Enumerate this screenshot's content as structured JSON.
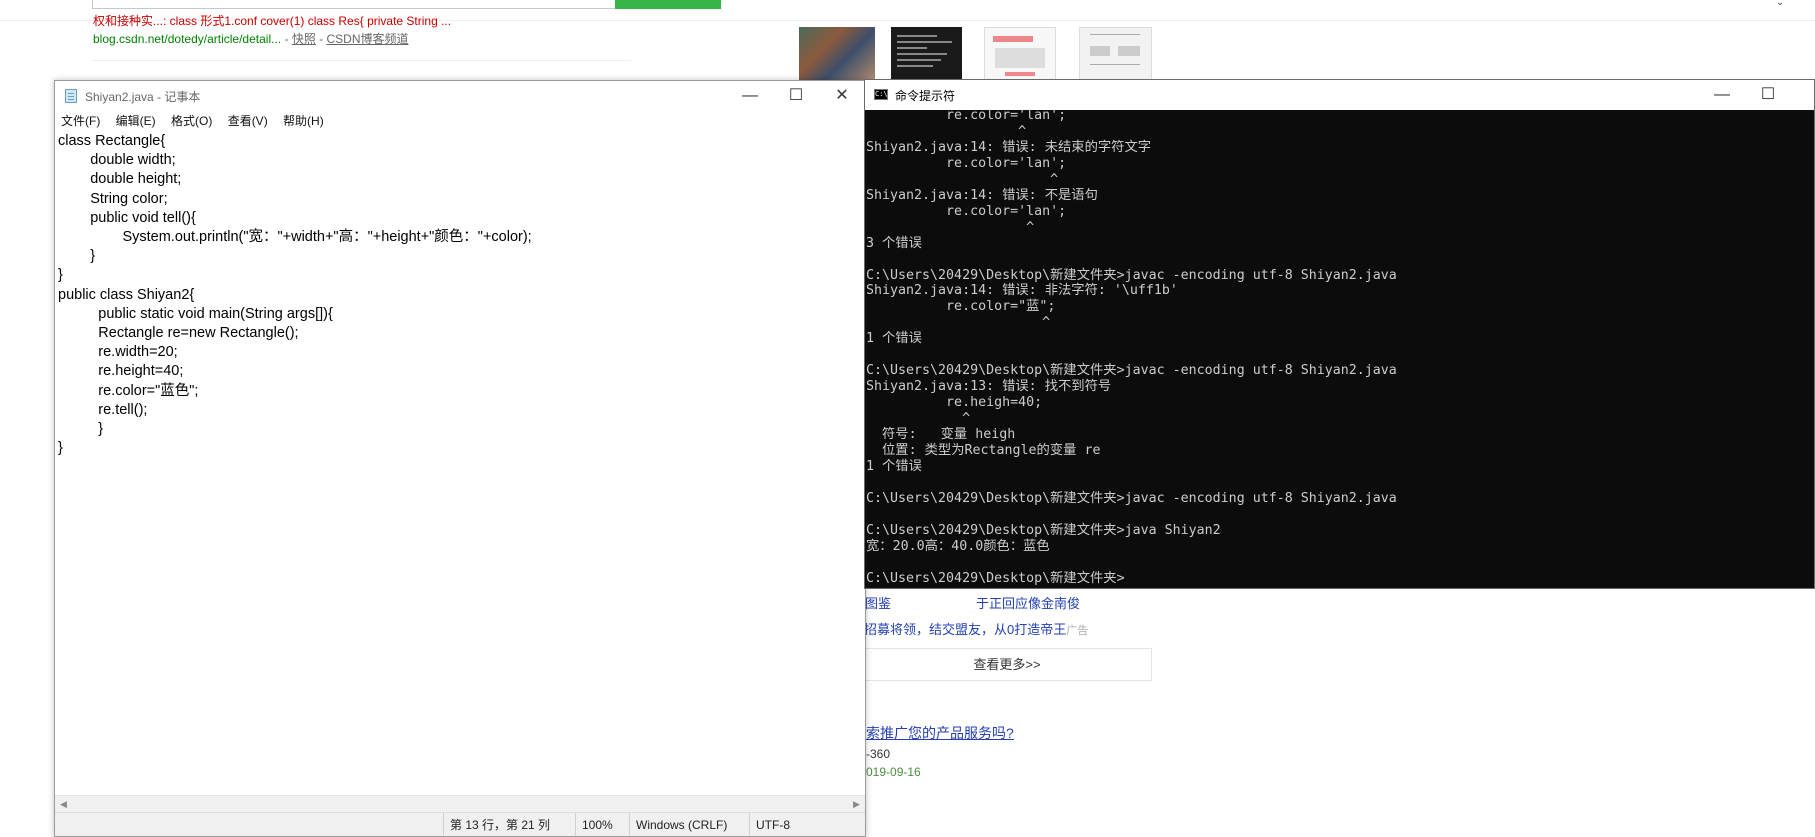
{
  "background_page": {
    "snippet": "权和接种实...: class 形式1.conf cover(1) class Res{ private String ...",
    "result_url": "blog.csdn.net/dotedy/article/detail...",
    "separator": "-",
    "snapshot_link": "快照",
    "separator2": "-",
    "channel_link": "CSDN博客频道",
    "link_1": "图鉴",
    "link_2": "于正回应像金南俊",
    "ad_text": "招募将领，结交盟友，从0打造帝王",
    "ad_tag": "广告",
    "more_button": "查看更多>>",
    "promo_link": "索推广您的产品服务吗?",
    "info_1": "-360",
    "info_2": "019-09-16"
  },
  "notepad": {
    "title": "Shiyan2.java - 记事本",
    "menu": [
      "文件(F)",
      "编辑(E)",
      "格式(O)",
      "查看(V)",
      "帮助(H)"
    ],
    "content": "class Rectangle{\n\tdouble width;\n\tdouble height;\n\tString color;\n\tpublic void tell(){\n\t\tSystem.out.println(\"宽：\"+width+\"高：\"+height+\"颜色：\"+color);\n\t}\n}\npublic class Shiyan2{\n\t  public static void main(String args[]){\n\t  Rectangle re=new Rectangle();\n\t  re.width=20;\n\t  re.height=40;\n\t  re.color=\"蓝色\";\n\t  re.tell();\n\t  }\n}",
    "status": {
      "position": "第 13 行，第 21 列",
      "zoom": "100%",
      "line_ending": "Windows (CRLF)",
      "encoding": "UTF-8"
    }
  },
  "cmd": {
    "title": "命令提示符",
    "icon_text": "C:\\",
    "output": "          re.color='lan';\n                   ^\nShiyan2.java:14: 错误: 未结束的字符文字\n          re.color='lan';\n                       ^\nShiyan2.java:14: 错误: 不是语句\n          re.color='lan';\n                    ^\n3 个错误\n\nC:\\Users\\20429\\Desktop\\新建文件夹>javac -encoding utf-8 Shiyan2.java\nShiyan2.java:14: 错误: 非法字符: '\\uff1b'\n          re.color=\"蓝\";\n                      ^\n1 个错误\n\nC:\\Users\\20429\\Desktop\\新建文件夹>javac -encoding utf-8 Shiyan2.java\nShiyan2.java:13: 错误: 找不到符号\n          re.heigh=40;\n            ^\n  符号:   变量 heigh\n  位置: 类型为Rectangle的变量 re\n1 个错误\n\nC:\\Users\\20429\\Desktop\\新建文件夹>javac -encoding utf-8 Shiyan2.java\n\nC:\\Users\\20429\\Desktop\\新建文件夹>java Shiyan2\n宽：20.0高：40.0颜色：蓝色\n\nC:\\Users\\20429\\Desktop\\新建文件夹>"
  },
  "window_controls": {
    "minimize": "—",
    "maximize": "☐",
    "close": "✕",
    "scroll_left": "◀",
    "scroll_right": "▶",
    "chevron": "⌄"
  }
}
